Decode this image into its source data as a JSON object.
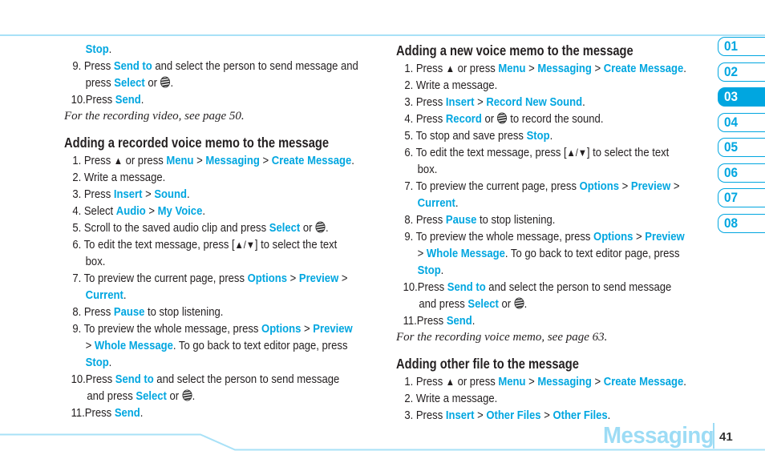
{
  "accent_color": "#00a6e0",
  "left_column": {
    "top_lines": [
      {
        "kind": "cont",
        "parts": [
          {
            "t": "Stop",
            "hl": true
          },
          {
            "t": "."
          }
        ]
      },
      {
        "kind": "item",
        "num": "9.",
        "parts": [
          {
            "t": "Press "
          },
          {
            "t": "Send to",
            "hl": true
          },
          {
            "t": " and select the person to send message and"
          }
        ]
      },
      {
        "kind": "cont",
        "parts": [
          {
            "t": "press "
          },
          {
            "t": "Select",
            "hl": true
          },
          {
            "t": " or "
          },
          {
            "icon": "globe"
          },
          {
            "t": "."
          }
        ]
      },
      {
        "kind": "item10",
        "num": "10.",
        "parts": [
          {
            "t": "Press "
          },
          {
            "t": "Send",
            "hl": true
          },
          {
            "t": "."
          }
        ]
      }
    ],
    "note_1": "For the recording video, see page 50.",
    "section_heading": "Adding a recorded voice memo to the message",
    "section_lines": [
      {
        "kind": "item",
        "num": "1.",
        "parts": [
          {
            "t": "Press "
          },
          {
            "icon": "up"
          },
          {
            "t": " or press "
          },
          {
            "t": "Menu",
            "hl": true
          },
          {
            "t": " > "
          },
          {
            "t": "Messaging",
            "hl": true
          },
          {
            "t": " > "
          },
          {
            "t": "Create Message",
            "hl": true
          },
          {
            "t": "."
          }
        ]
      },
      {
        "kind": "item",
        "num": "2.",
        "parts": [
          {
            "t": "Write a message."
          }
        ]
      },
      {
        "kind": "item",
        "num": "3.",
        "parts": [
          {
            "t": "Press "
          },
          {
            "t": "Insert",
            "hl": true
          },
          {
            "t": " > "
          },
          {
            "t": "Sound",
            "hl": true
          },
          {
            "t": "."
          }
        ]
      },
      {
        "kind": "item",
        "num": "4.",
        "parts": [
          {
            "t": "Select "
          },
          {
            "t": "Audio",
            "hl": true
          },
          {
            "t": " > "
          },
          {
            "t": "My Voice",
            "hl": true
          },
          {
            "t": "."
          }
        ]
      },
      {
        "kind": "item",
        "num": "5.",
        "parts": [
          {
            "t": "Scroll to the saved audio clip and press "
          },
          {
            "t": "Select",
            "hl": true
          },
          {
            "t": " or "
          },
          {
            "icon": "globe"
          },
          {
            "t": "."
          }
        ]
      },
      {
        "kind": "item",
        "num": "6.",
        "parts": [
          {
            "t": "To edit the text message, press ["
          },
          {
            "icon": "updown"
          },
          {
            "t": "] to select the text"
          }
        ]
      },
      {
        "kind": "cont",
        "parts": [
          {
            "t": "box."
          }
        ]
      },
      {
        "kind": "item",
        "num": "7.",
        "parts": [
          {
            "t": "To preview the current page, press "
          },
          {
            "t": "Options",
            "hl": true
          },
          {
            "t": " > "
          },
          {
            "t": "Preview",
            "hl": true
          },
          {
            "t": " >"
          }
        ]
      },
      {
        "kind": "cont",
        "parts": [
          {
            "t": "Current",
            "hl": true
          },
          {
            "t": "."
          }
        ]
      },
      {
        "kind": "item",
        "num": "8.",
        "parts": [
          {
            "t": "Press "
          },
          {
            "t": "Pause",
            "hl": true
          },
          {
            "t": " to stop listening."
          }
        ]
      },
      {
        "kind": "item",
        "num": "9.",
        "parts": [
          {
            "t": "To preview the whole message, press "
          },
          {
            "t": "Options",
            "hl": true
          },
          {
            "t": " > "
          },
          {
            "t": "Preview",
            "hl": true
          }
        ]
      },
      {
        "kind": "cont",
        "parts": [
          {
            "t": "> "
          },
          {
            "t": "Whole Message",
            "hl": true
          },
          {
            "t": ". To go back to text editor page, press"
          }
        ]
      },
      {
        "kind": "cont",
        "parts": [
          {
            "t": "Stop",
            "hl": true
          },
          {
            "t": "."
          }
        ]
      },
      {
        "kind": "item10",
        "num": "10.",
        "parts": [
          {
            "t": "Press "
          },
          {
            "t": "Send to",
            "hl": true
          },
          {
            "t": " and select the person to send message"
          }
        ]
      },
      {
        "kind": "cont2",
        "parts": [
          {
            "t": "and press "
          },
          {
            "t": "Select",
            "hl": true
          },
          {
            "t": " or "
          },
          {
            "icon": "globe"
          },
          {
            "t": "."
          }
        ]
      },
      {
        "kind": "item10",
        "num": "11.",
        "parts": [
          {
            "t": "Press "
          },
          {
            "t": "Send",
            "hl": true
          },
          {
            "t": "."
          }
        ]
      }
    ]
  },
  "right_column": {
    "section_1_heading": "Adding a new voice memo to the message",
    "section_1_lines": [
      {
        "kind": "item",
        "num": "1.",
        "parts": [
          {
            "t": "Press "
          },
          {
            "icon": "up"
          },
          {
            "t": " or press "
          },
          {
            "t": "Menu",
            "hl": true
          },
          {
            "t": " > "
          },
          {
            "t": "Messaging",
            "hl": true
          },
          {
            "t": " > "
          },
          {
            "t": "Create Message",
            "hl": true
          },
          {
            "t": "."
          }
        ]
      },
      {
        "kind": "item",
        "num": "2.",
        "parts": [
          {
            "t": "Write a message."
          }
        ]
      },
      {
        "kind": "item",
        "num": "3.",
        "parts": [
          {
            "t": "Press "
          },
          {
            "t": "Insert",
            "hl": true
          },
          {
            "t": " > "
          },
          {
            "t": "Record New Sound",
            "hl": true
          },
          {
            "t": "."
          }
        ]
      },
      {
        "kind": "item",
        "num": "4.",
        "parts": [
          {
            "t": "Press "
          },
          {
            "t": "Record",
            "hl": true
          },
          {
            "t": " or "
          },
          {
            "icon": "globe"
          },
          {
            "t": " to record the sound."
          }
        ]
      },
      {
        "kind": "item",
        "num": "5.",
        "parts": [
          {
            "t": "To stop and save press "
          },
          {
            "t": "Stop",
            "hl": true
          },
          {
            "t": "."
          }
        ]
      },
      {
        "kind": "item",
        "num": "6.",
        "parts": [
          {
            "t": "To edit the text message, press ["
          },
          {
            "icon": "updown"
          },
          {
            "t": "] to select the text"
          }
        ]
      },
      {
        "kind": "cont",
        "parts": [
          {
            "t": "box."
          }
        ]
      },
      {
        "kind": "item",
        "num": "7.",
        "parts": [
          {
            "t": "To preview the current page, press "
          },
          {
            "t": "Options",
            "hl": true
          },
          {
            "t": " > "
          },
          {
            "t": "Preview",
            "hl": true
          },
          {
            "t": " >"
          }
        ]
      },
      {
        "kind": "cont",
        "parts": [
          {
            "t": "Current",
            "hl": true
          },
          {
            "t": "."
          }
        ]
      },
      {
        "kind": "item",
        "num": "8.",
        "parts": [
          {
            "t": "Press "
          },
          {
            "t": "Pause",
            "hl": true
          },
          {
            "t": " to stop listening."
          }
        ]
      },
      {
        "kind": "item",
        "num": "9.",
        "parts": [
          {
            "t": "To preview the whole message, press "
          },
          {
            "t": "Options",
            "hl": true
          },
          {
            "t": " > "
          },
          {
            "t": "Preview",
            "hl": true
          }
        ]
      },
      {
        "kind": "cont",
        "parts": [
          {
            "t": "> "
          },
          {
            "t": "Whole Message",
            "hl": true
          },
          {
            "t": ". To go back to text editor page, press"
          }
        ]
      },
      {
        "kind": "cont",
        "parts": [
          {
            "t": "Stop",
            "hl": true
          },
          {
            "t": "."
          }
        ]
      },
      {
        "kind": "item10",
        "num": "10.",
        "parts": [
          {
            "t": "Press "
          },
          {
            "t": "Send to",
            "hl": true
          },
          {
            "t": " and select the person to send message"
          }
        ]
      },
      {
        "kind": "cont2",
        "parts": [
          {
            "t": "and press "
          },
          {
            "t": "Select",
            "hl": true
          },
          {
            "t": " or "
          },
          {
            "icon": "globe"
          },
          {
            "t": "."
          }
        ]
      },
      {
        "kind": "item10",
        "num": "11.",
        "parts": [
          {
            "t": "Press "
          },
          {
            "t": "Send",
            "hl": true
          },
          {
            "t": "."
          }
        ]
      }
    ],
    "note_2": "For the recording voice memo, see page 63.",
    "section_2_heading": "Adding other file to the message",
    "section_2_lines": [
      {
        "kind": "item",
        "num": "1.",
        "parts": [
          {
            "t": "Press "
          },
          {
            "icon": "up"
          },
          {
            "t": " or press "
          },
          {
            "t": "Menu",
            "hl": true
          },
          {
            "t": " > "
          },
          {
            "t": "Messaging",
            "hl": true
          },
          {
            "t": " > "
          },
          {
            "t": "Create Message",
            "hl": true
          },
          {
            "t": "."
          }
        ]
      },
      {
        "kind": "item",
        "num": "2.",
        "parts": [
          {
            "t": "Write a message."
          }
        ]
      },
      {
        "kind": "item",
        "num": "3.",
        "parts": [
          {
            "t": "Press "
          },
          {
            "t": "Insert",
            "hl": true
          },
          {
            "t": " > "
          },
          {
            "t": "Other Files",
            "hl": true
          },
          {
            "t": " > "
          },
          {
            "t": "Other Files",
            "hl": true
          },
          {
            "t": "."
          }
        ]
      }
    ]
  },
  "chapter_tabs": [
    {
      "label": "01",
      "active": false
    },
    {
      "label": "02",
      "active": false
    },
    {
      "label": "03",
      "active": true
    },
    {
      "label": "04",
      "active": false
    },
    {
      "label": "05",
      "active": false
    },
    {
      "label": "06",
      "active": false
    },
    {
      "label": "07",
      "active": false
    },
    {
      "label": "08",
      "active": false
    }
  ],
  "footer": {
    "chapter_title": "Messaging",
    "page_number": "41"
  }
}
